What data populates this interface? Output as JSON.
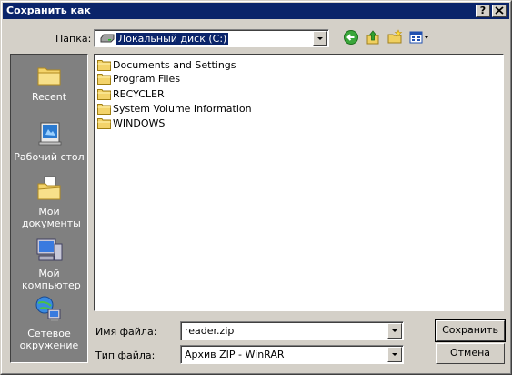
{
  "dialog": {
    "title": "Сохранить как",
    "help_button": "?",
    "close_button": "X"
  },
  "folder": {
    "label": "Папка:",
    "value": "Локальный диск (C:)"
  },
  "places": [
    {
      "label": "Recent",
      "icon": "recent-folder-icon"
    },
    {
      "label": "Рабочий стол",
      "icon": "desktop-icon"
    },
    {
      "label": "Мои документы",
      "icon": "my-documents-icon"
    },
    {
      "label": "Мой компьютер",
      "icon": "my-computer-icon"
    },
    {
      "label": "Сетевое окружение",
      "icon": "network-icon"
    }
  ],
  "files": [
    {
      "name": "Documents and Settings",
      "icon": "folder-icon"
    },
    {
      "name": "Program Files",
      "icon": "folder-icon"
    },
    {
      "name": "RECYCLER",
      "icon": "folder-icon"
    },
    {
      "name": "System Volume Information",
      "icon": "folder-icon"
    },
    {
      "name": "WINDOWS",
      "icon": "folder-icon"
    }
  ],
  "filename": {
    "label": "Имя файла:",
    "value": "reader.zip"
  },
  "filetype": {
    "label": "Тип файла:",
    "value": "Архив ZIP - WinRAR"
  },
  "buttons": {
    "save": "Сохранить",
    "cancel": "Отмена"
  },
  "colors": {
    "titlebar": "#0a246a",
    "face": "#d4d0c8",
    "places_bar": "#808080"
  }
}
